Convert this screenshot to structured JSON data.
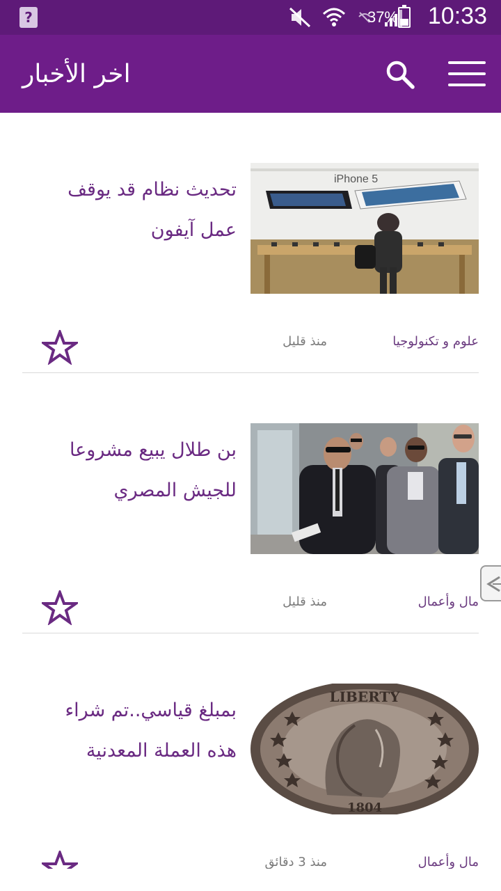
{
  "status_bar": {
    "battery_percent": "37%",
    "battery_level": 0.37,
    "time": "10:33",
    "icons": [
      "notification-icon",
      "mute-icon",
      "wifi-icon",
      "signal-off-icon",
      "cell-signal-icon",
      "battery-charging-icon"
    ]
  },
  "app_bar": {
    "title": "اخر الأخبار",
    "search_icon": "search-icon",
    "menu_icon": "menu-icon"
  },
  "colors": {
    "status_bar": "#5e1a78",
    "app_bar": "#6e1d89",
    "accent": "#6a2a82"
  },
  "articles": [
    {
      "title": "تحديث نظام قد يوقف عمل آيفون",
      "category": "علوم و تكنولوجيا",
      "time": "منذ قليل",
      "image_caption": "iPhone 5",
      "image": "iphone-store-photo"
    },
    {
      "title": "بن طلال يبيع مشروعا للجيش المصري",
      "category": "مال وأعمال",
      "time": "منذ قليل",
      "image": "businessmen-photo"
    },
    {
      "title": "بمبلغ قياسي..تم شراء هذه العملة المعدنية",
      "category": "مال وأعمال",
      "time": "منذ 3 دقائق",
      "coin_text": "LIBERTY",
      "coin_year": "1804",
      "image": "silver-dollar-coin-photo"
    }
  ]
}
